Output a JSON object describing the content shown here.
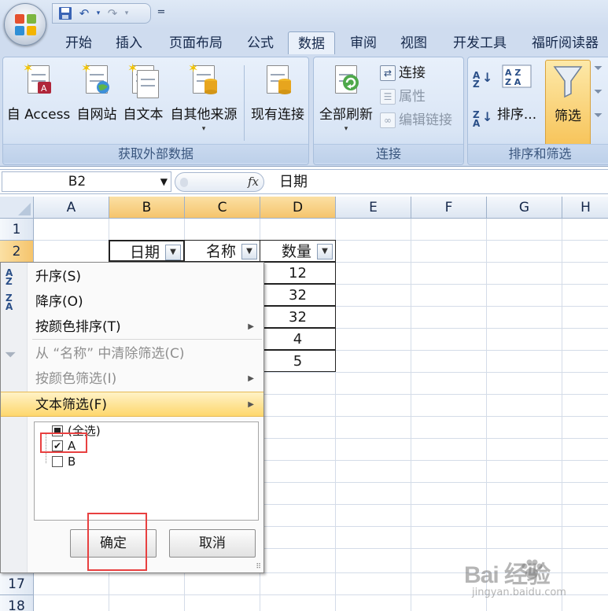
{
  "qat": {
    "save_icon": "save-icon",
    "undo_icon": "undo-icon",
    "redo_icon": "redo-icon",
    "customize": "="
  },
  "tabs": [
    {
      "label": "开始"
    },
    {
      "label": "插入"
    },
    {
      "label": "页面布局"
    },
    {
      "label": "公式"
    },
    {
      "label": "数据",
      "active": true
    },
    {
      "label": "审阅"
    },
    {
      "label": "视图"
    },
    {
      "label": "开发工具"
    },
    {
      "label": "福昕阅读器"
    }
  ],
  "ribbon": {
    "get_external": {
      "label": "获取外部数据",
      "from_access": "自 Access",
      "from_web": "自网站",
      "from_text": "自文本",
      "from_other": "自其他来源",
      "existing": "现有连接"
    },
    "connections": {
      "label": "连接",
      "refresh_all": "全部刷新",
      "connections": "连接",
      "properties": "属性",
      "edit_links": "编辑链接"
    },
    "sort_filter": {
      "label": "排序和筛选",
      "sort": "排序...",
      "filter": "筛选"
    }
  },
  "formula_bar": {
    "name_box": "B2",
    "fx": "fx",
    "value": "日期"
  },
  "columns": [
    "A",
    "B",
    "C",
    "D",
    "E",
    "F",
    "G",
    "H"
  ],
  "rows": [
    "1",
    "2",
    "17",
    "18"
  ],
  "table": {
    "headers": [
      "日期",
      "名称",
      "数量"
    ],
    "quantities": [
      "12",
      "32",
      "32",
      "4",
      "5"
    ]
  },
  "menu": {
    "sort_asc": "升序(S)",
    "sort_desc": "降序(O)",
    "sort_color": "按颜色排序(T)",
    "clear_filter": "从 “名称” 中清除筛选(C)",
    "filter_color": "按颜色筛选(I)",
    "text_filter": "文本筛选(F)",
    "items": [
      {
        "label": "(全选)",
        "state": "partial"
      },
      {
        "label": "A",
        "state": "checked"
      },
      {
        "label": "B",
        "state": "unchecked"
      }
    ],
    "ok": "确定",
    "cancel": "取消"
  },
  "watermark": {
    "main": "Bai  经验",
    "sub": "jingyan.baidu.com"
  },
  "colors": {
    "accent_red": "#e84040",
    "selected_header": "#f5c46c",
    "highlight": "#fed76c"
  }
}
